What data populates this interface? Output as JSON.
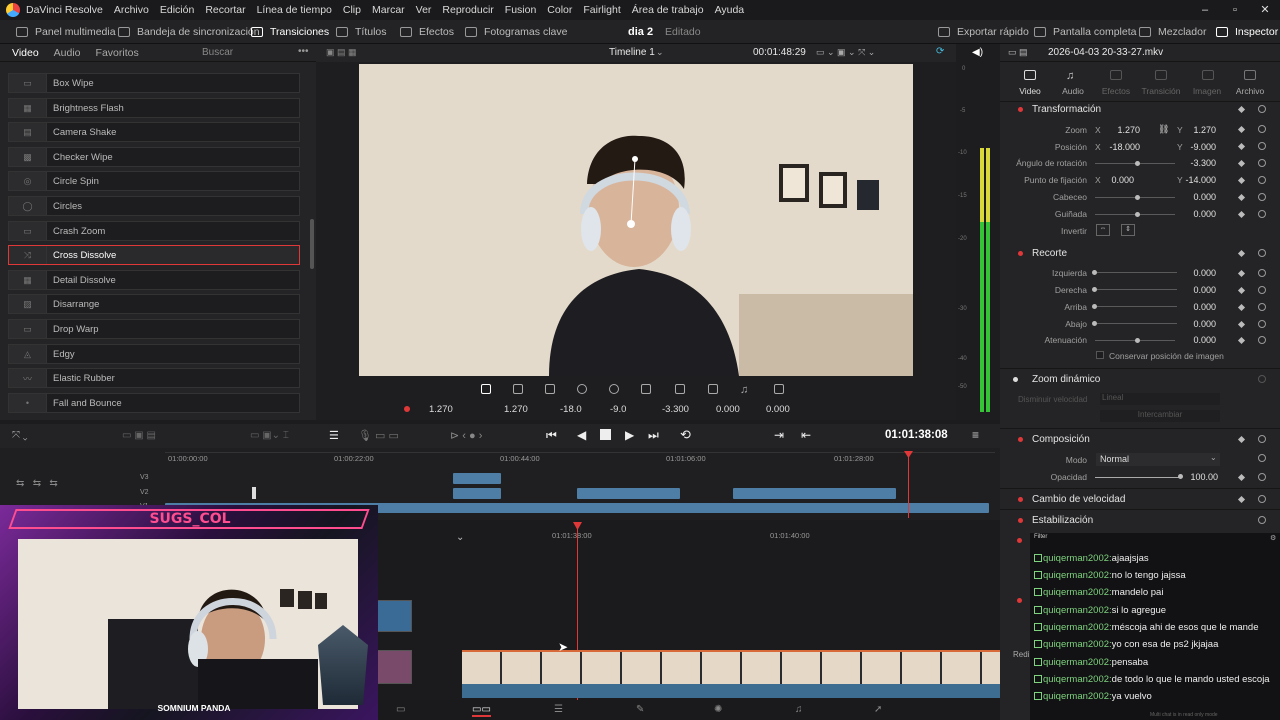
{
  "app": {
    "menu": [
      "DaVinci Resolve",
      "Archivo",
      "Edición",
      "Recortar",
      "Línea de tiempo",
      "Clip",
      "Marcar",
      "Ver",
      "Reproducir",
      "Fusion",
      "Color",
      "Fairlight",
      "Área de trabajo",
      "Ayuda"
    ]
  },
  "toolbar": {
    "media_pool": "Panel multimedia",
    "sync_bin": "Bandeja de sincronización",
    "transitions": "Transiciones",
    "titles": "Títulos",
    "effects": "Efectos",
    "keyframes": "Fotogramas clave",
    "project_title": "dia 2",
    "project_status": "Editado",
    "quick_export": "Exportar rápido",
    "fullscreen": "Pantalla completa",
    "mixer": "Mezclador",
    "inspector": "Inspector"
  },
  "effects_library": {
    "tabs": [
      "Video",
      "Audio",
      "Favoritos"
    ],
    "search_placeholder": "Buscar",
    "items": [
      "Box Wipe",
      "Brightness Flash",
      "Camera Shake",
      "Checker Wipe",
      "Circle Spin",
      "Circles",
      "Crash Zoom",
      "Cross Dissolve",
      "Detail Dissolve",
      "Disarrange",
      "Drop Warp",
      "Edgy",
      "Elastic Rubber",
      "Fall and Bounce"
    ],
    "selected": "Cross Dissolve"
  },
  "viewer": {
    "timeline_name": "Timeline 1",
    "timecode": "00:01:48:29",
    "zoom_x": "1.270",
    "zoom_y": "1.270",
    "pos_x": "-18.0",
    "pos_y": "-9.0",
    "rotation": "-3.300",
    "crop_a": "0.000",
    "crop_b": "0.000"
  },
  "meters": {
    "scale": [
      "0",
      "-5",
      "-10",
      "-15",
      "-20",
      "-30",
      "-40",
      "-50"
    ]
  },
  "inspector": {
    "file_name": "2026-04-03 20-33-27.mkv",
    "tabs": [
      "Video",
      "Audio",
      "Efectos",
      "Transición",
      "Imagen",
      "Archivo"
    ],
    "transform": {
      "title": "Transformación",
      "zoom_label": "Zoom",
      "zoom_x": "1.270",
      "zoom_y": "1.270",
      "position_label": "Posición",
      "pos_x": "-18.000",
      "pos_y": "-9.000",
      "rotation_label": "Ángulo de rotación",
      "rotation": "-3.300",
      "anchor_label": "Punto de fijación",
      "anchor_x": "0.000",
      "anchor_y": "-14.000",
      "pitch_label": "Cabeceo",
      "pitch": "0.000",
      "yaw_label": "Guiñada",
      "yaw": "0.000",
      "flip_label": "Invertir",
      "x_label": "X",
      "y_label": "Y"
    },
    "crop": {
      "title": "Recorte",
      "left_label": "Izquierda",
      "left": "0.000",
      "right_label": "Derecha",
      "right": "0.000",
      "top_label": "Arriba",
      "top": "0.000",
      "bottom_label": "Abajo",
      "bottom": "0.000",
      "soften_label": "Atenuación",
      "soften": "0.000",
      "retain_label": "Conservar posición de imagen"
    },
    "dynamic_zoom": {
      "title": "Zoom dinámico",
      "ease_label": "Disminuir velocidad",
      "ease_value": "Lineal",
      "swap_label": "Intercambiar"
    },
    "composite": {
      "title": "Composición",
      "mode_label": "Modo",
      "mode": "Normal",
      "opacity_label": "Opacidad",
      "opacity": "100.00"
    },
    "speed_change": "Cambio de velocidad",
    "stabilization": "Estabilización",
    "partial_label": "Redi"
  },
  "transport": {
    "timecode": "01:01:38:08"
  },
  "timeline": {
    "ruler": [
      "01:00:00:00",
      "01:00:22:00",
      "01:00:44:00",
      "01:01:06:00",
      "01:01:28:00"
    ],
    "tracks": [
      "V3",
      "V2",
      "V1"
    ],
    "lower_ruler": [
      "01:01:38:00",
      "01:01:40:00"
    ]
  },
  "stream_overlay": {
    "username": "SUGS_COL",
    "brand": "SOMNIUM PANDA"
  },
  "chat": {
    "header": "Filter",
    "messages": [
      {
        "user": "quiqerman2002:",
        "text": "ajaajsjas"
      },
      {
        "user": "quiqerman2002:",
        "text": "no lo tengo jajssa"
      },
      {
        "user": "quiqerman2002:",
        "text": "mandelo pai"
      },
      {
        "user": "quiqerman2002:",
        "text": "si lo agregue"
      },
      {
        "user": "quiqerman2002:",
        "text": "méscoja ahi de esos que le mande"
      },
      {
        "user": "quiqerman2002:",
        "text": "yo con esa de ps2 jkjajaa"
      },
      {
        "user": "quiqerman2002:",
        "text": "pensaba"
      },
      {
        "user": "quiqerman2002:",
        "text": "de todo lo que le mando usted escoja"
      },
      {
        "user": "quiqerman2002:",
        "text": "ya vuelvo"
      }
    ],
    "footer": "Multi chat is in read only mode"
  },
  "colors": {
    "accent_red": "#e03838",
    "clip_blue": "#4e7ea6",
    "meter_green": "#35c435",
    "meter_yellow": "#d8d83a",
    "chat_user": "#7fd27f"
  }
}
